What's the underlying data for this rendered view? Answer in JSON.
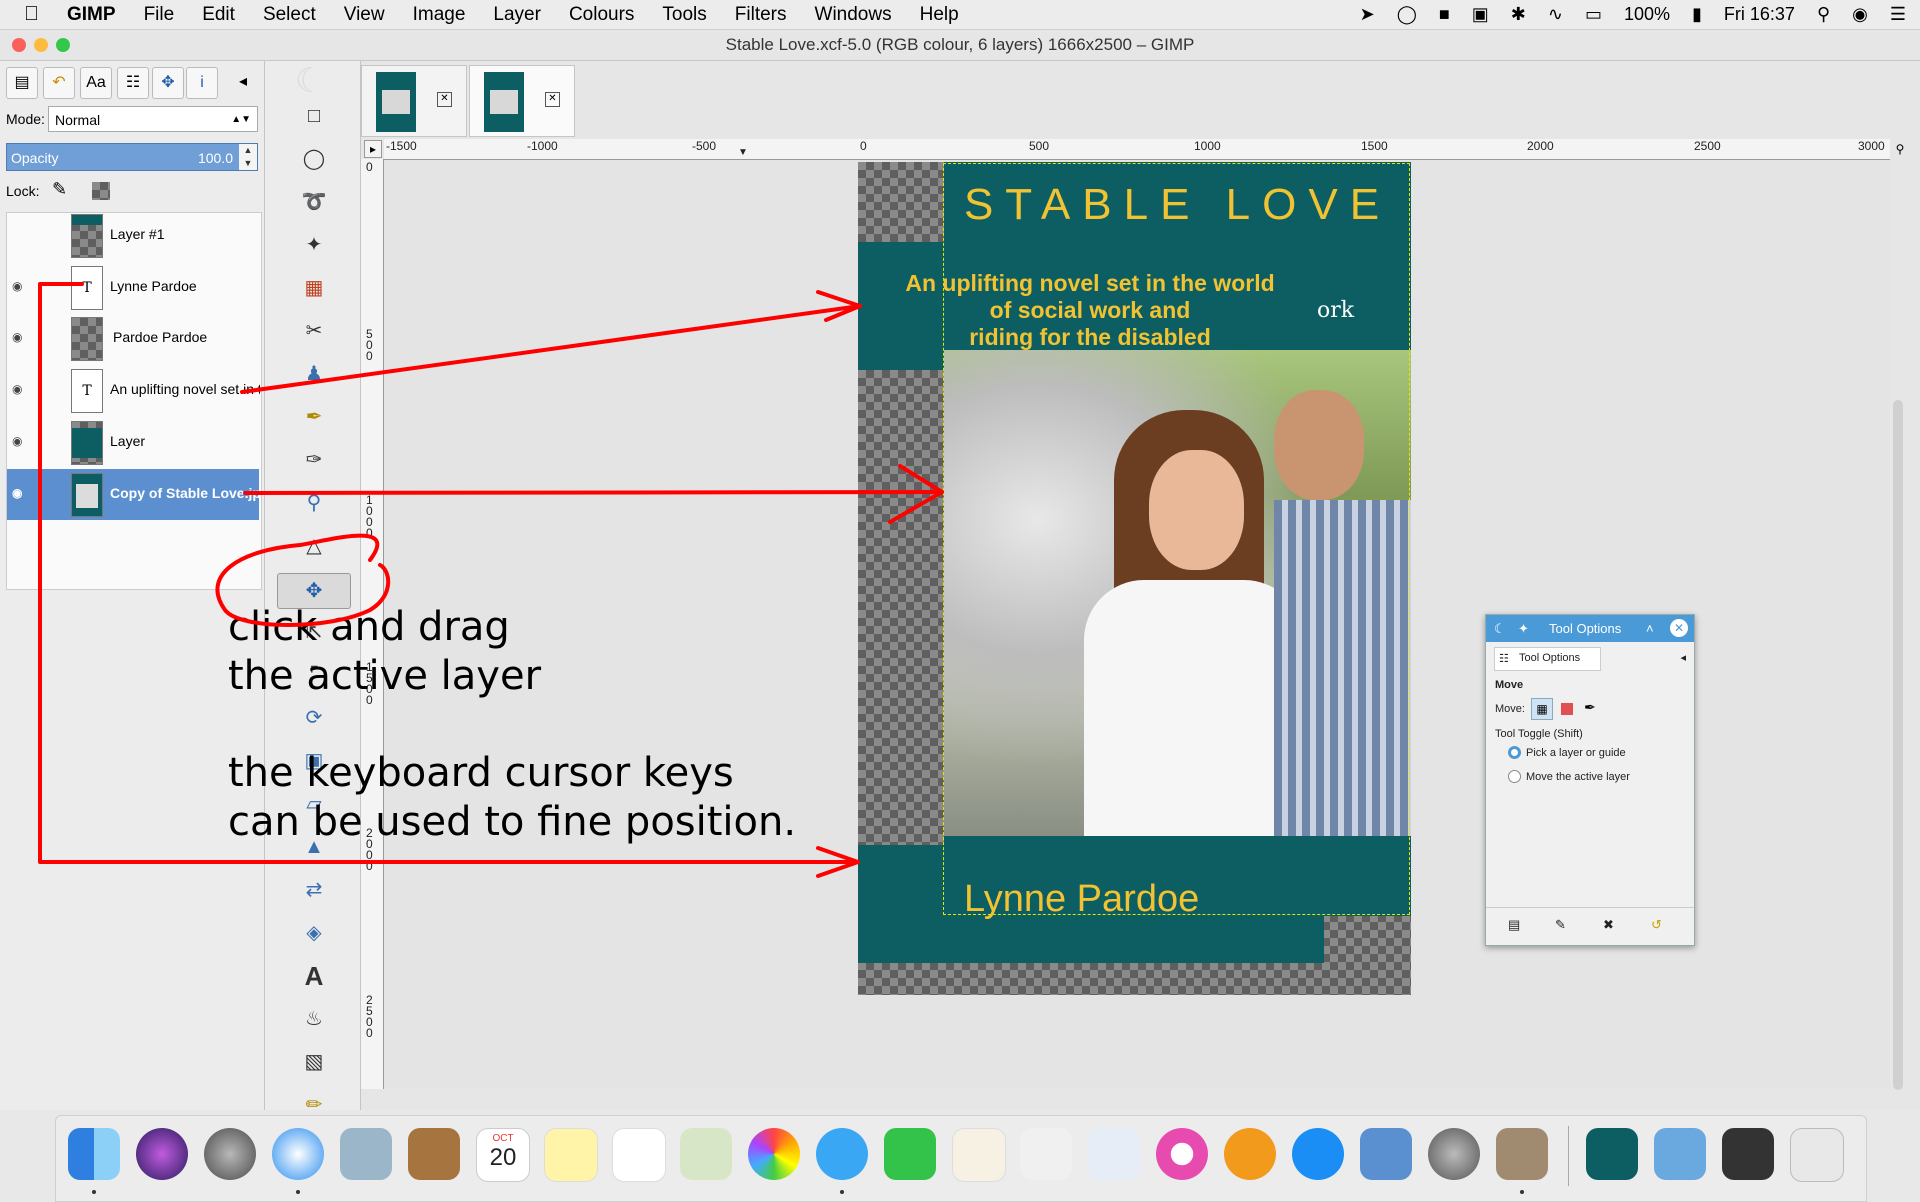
{
  "menubar": {
    "apple": "",
    "app_name": "GIMP",
    "items": [
      "File",
      "Edit",
      "Select",
      "View",
      "Image",
      "Layer",
      "Colours",
      "Tools",
      "Filters",
      "Windows",
      "Help"
    ],
    "battery": "100%",
    "clock": "Fri 16:37"
  },
  "window": {
    "title": "Stable Love.xcf-5.0 (RGB colour, 6 layers) 1666x2500 – GIMP"
  },
  "layers_panel": {
    "mode_label": "Mode:",
    "mode_value": "Normal",
    "opacity_label": "Opacity",
    "opacity_value": "100.0",
    "lock_label": "Lock:",
    "layers": [
      {
        "name": "Layer #1",
        "visible": false,
        "selected": false
      },
      {
        "name": "Lynne Pardoe",
        "visible": true,
        "selected": false
      },
      {
        "name": "Pardoe Pardoe",
        "visible": true,
        "selected": false
      },
      {
        "name": "An uplifting novel set in the",
        "visible": true,
        "selected": false
      },
      {
        "name": "Layer",
        "visible": true,
        "selected": false
      },
      {
        "name": "Copy of Stable Love.jpg",
        "visible": true,
        "selected": true
      }
    ]
  },
  "ruler": {
    "h_labels": [
      "-1500",
      "-1000",
      "-500",
      "0",
      "500",
      "1000",
      "1500",
      "2000",
      "2500",
      "3000"
    ],
    "v_labels": [
      "0",
      "500",
      "1000",
      "1500",
      "2000",
      "2500"
    ]
  },
  "cover": {
    "title": "STABLE LOVE",
    "tagline_1": "An uplifting novel set in the world",
    "tagline_2": "of social work and",
    "tagline_3": "riding for the disabled",
    "hidden_fragment": "ork",
    "author": "Lynne Pardoe"
  },
  "annotation": {
    "line1": "click and drag",
    "line2": "the active layer",
    "line3": "the keyboard cursor  keys",
    "line4": "can be used to fine position."
  },
  "tool_options": {
    "window_title": "Tool Options",
    "tab_label": "Tool Options",
    "section": "Move",
    "move_label": "Move:",
    "toggle_label": "Tool Toggle  (Shift)",
    "option_pick": "Pick a layer or guide",
    "option_move": "Move the active layer"
  },
  "dock": {
    "calendar_month": "OCT",
    "calendar_day": "20"
  },
  "colors": {
    "teal": "#0c5e63",
    "gold": "#f1c232",
    "selection_blue": "#5b8fcf",
    "annotation_red": "#ff0000"
  }
}
